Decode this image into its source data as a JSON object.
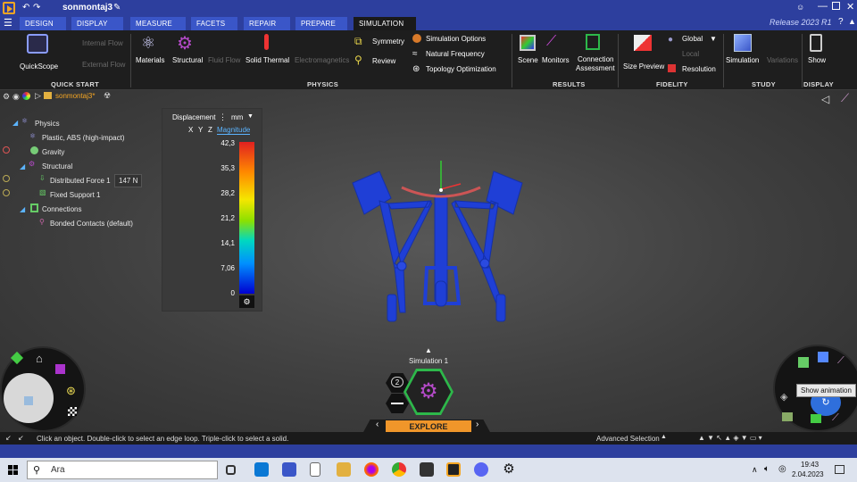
{
  "titlebar": {
    "title": "sonmontaj3",
    "release": "Release 2023 R1"
  },
  "tabs": [
    {
      "label": "Design"
    },
    {
      "label": "Display"
    },
    {
      "label": "Measure"
    },
    {
      "label": "Facets"
    },
    {
      "label": "Repair"
    },
    {
      "label": "Prepare"
    },
    {
      "label": "Simulation"
    }
  ],
  "ribbon": {
    "quickstart": {
      "label": "QUICK START",
      "quickscope": "QuickScope",
      "internal_flow": "Internal Flow",
      "external_flow": "External Flow"
    },
    "physics": {
      "label": "PHYSICS",
      "materials": "Materials",
      "structural": "Structural",
      "fluid_flow": "Fluid Flow",
      "solid_thermal": "Solid Thermal",
      "electromagnetics": "Electromagnetics",
      "symmetry": "Symmetry",
      "review": "Review",
      "simulation_options": "Simulation Options",
      "natural_frequency": "Natural Frequency",
      "topology_optimization": "Topology Optimization"
    },
    "results": {
      "label": "RESULTS",
      "scene": "Scene",
      "monitors": "Monitors",
      "connection": "Connection",
      "assessment": "Assessment"
    },
    "fidelity": {
      "label": "FIDELITY",
      "size_preview": "Size Preview",
      "global": "Global",
      "local": "Local",
      "resolution": "Resolution"
    },
    "study": {
      "label": "STUDY",
      "simulation": "Simulation",
      "variations": "Variations"
    },
    "display": {
      "label": "DISPLAY",
      "show": "Show"
    }
  },
  "breadcrumb": {
    "name": "sonmontaj3*"
  },
  "tree": {
    "physics": "Physics",
    "material": "Plastic, ABS (high-impact)",
    "gravity": "Gravity",
    "structural": "Structural",
    "force": "Distributed Force 1",
    "force_value": "147 N",
    "support": "Fixed Support 1",
    "connections": "Connections",
    "contacts": "Bonded Contacts (default)"
  },
  "legend": {
    "title": "Displacement",
    "unit": "mm",
    "x": "X",
    "y": "Y",
    "z": "Z",
    "magnitude": "Magnitude",
    "values": [
      "42,3",
      "35,3",
      "28,2",
      "21,2",
      "14,1",
      "7,06",
      "0"
    ]
  },
  "viewport": {
    "sim_label": "Simulation 1",
    "explore": "Explore",
    "badge": "2",
    "tooltip": "Show animation"
  },
  "status": {
    "hint": "Click an object. Double-click to select an edge loop. Triple-click to select a solid.",
    "advanced": "Advanced Selection"
  },
  "taskbar": {
    "search": "Ara",
    "time": "19:43",
    "date": "2.04.2023"
  },
  "colors": {
    "accent": "#2d3f9e",
    "tab": "#3a56c8",
    "model": "#1f3fd6",
    "explore": "#f0962a"
  }
}
